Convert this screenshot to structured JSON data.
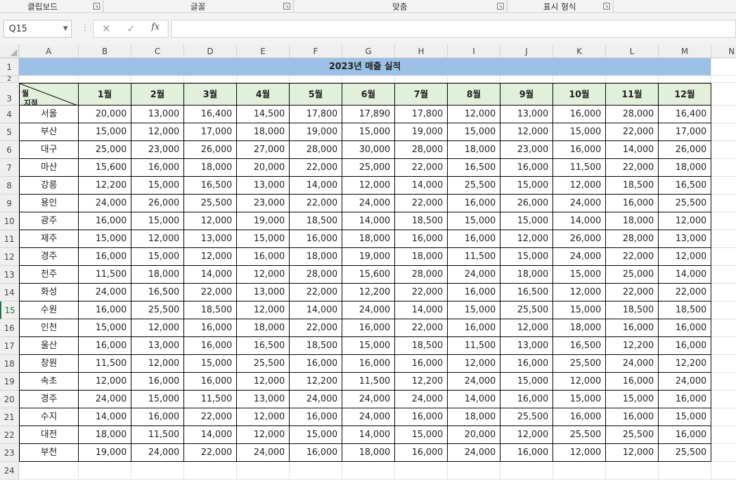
{
  "ribbon": {
    "groups": [
      {
        "label": "클립보드"
      },
      {
        "label": "글꼴"
      },
      {
        "label": "맞춤"
      },
      {
        "label": "표시 형식"
      }
    ]
  },
  "formula_bar": {
    "name_box": "Q15",
    "cancel_icon": "✕",
    "enter_icon": "✓",
    "fx_label": "fx",
    "formula": ""
  },
  "columns": [
    "A",
    "B",
    "C",
    "D",
    "E",
    "F",
    "G",
    "H",
    "I",
    "J",
    "K",
    "L",
    "M",
    "N"
  ],
  "rows": [
    "1",
    "2",
    "3",
    "4",
    "5",
    "6",
    "7",
    "8",
    "9",
    "10",
    "11",
    "12",
    "13",
    "14",
    "15",
    "16",
    "17",
    "18",
    "19",
    "20",
    "21",
    "22",
    "23",
    "24"
  ],
  "selected_row": "15",
  "sheet": {
    "title": "2023년 매출 실적",
    "header_corner": {
      "top": "월",
      "bottom": "지점"
    },
    "months": [
      "1월",
      "2월",
      "3월",
      "4월",
      "5월",
      "6월",
      "7월",
      "8월",
      "9월",
      "10월",
      "11월",
      "12월"
    ],
    "data": [
      {
        "branch": "서울",
        "values": [
          "20,000",
          "13,000",
          "16,400",
          "14,500",
          "17,800",
          "17,890",
          "17,800",
          "12,000",
          "13,000",
          "16,000",
          "28,000",
          "16,400"
        ]
      },
      {
        "branch": "부산",
        "values": [
          "15,000",
          "12,000",
          "17,000",
          "18,000",
          "19,000",
          "15,000",
          "19,000",
          "15,000",
          "12,000",
          "15,000",
          "22,000",
          "17,000"
        ]
      },
      {
        "branch": "대구",
        "values": [
          "25,000",
          "23,000",
          "26,000",
          "27,000",
          "28,000",
          "30,000",
          "28,000",
          "18,000",
          "23,000",
          "16,000",
          "14,000",
          "26,000"
        ]
      },
      {
        "branch": "마산",
        "values": [
          "15,600",
          "16,000",
          "18,000",
          "20,000",
          "22,000",
          "25,000",
          "22,000",
          "16,500",
          "16,000",
          "11,500",
          "22,000",
          "18,000"
        ]
      },
      {
        "branch": "강릉",
        "values": [
          "12,200",
          "15,000",
          "16,500",
          "13,000",
          "14,000",
          "12,000",
          "14,000",
          "25,500",
          "15,000",
          "12,000",
          "18,500",
          "16,500"
        ]
      },
      {
        "branch": "용인",
        "values": [
          "24,000",
          "26,000",
          "25,500",
          "23,000",
          "22,000",
          "24,000",
          "22,000",
          "16,000",
          "26,000",
          "24,000",
          "16,000",
          "25,500"
        ]
      },
      {
        "branch": "광주",
        "values": [
          "16,000",
          "15,000",
          "12,000",
          "19,000",
          "18,500",
          "14,000",
          "18,500",
          "15,000",
          "15,000",
          "14,000",
          "18,000",
          "12,000"
        ]
      },
      {
        "branch": "제주",
        "values": [
          "15,000",
          "12,000",
          "13,000",
          "15,000",
          "16,000",
          "18,000",
          "16,000",
          "16,000",
          "12,000",
          "26,000",
          "28,000",
          "13,000"
        ]
      },
      {
        "branch": "경주",
        "values": [
          "16,000",
          "15,000",
          "12,000",
          "16,000",
          "18,000",
          "19,000",
          "18,000",
          "11,500",
          "15,000",
          "24,000",
          "22,000",
          "12,000"
        ]
      },
      {
        "branch": "전주",
        "values": [
          "11,500",
          "18,000",
          "14,000",
          "12,000",
          "28,000",
          "15,600",
          "28,000",
          "24,000",
          "18,000",
          "15,000",
          "25,000",
          "14,000"
        ]
      },
      {
        "branch": "화성",
        "values": [
          "24,000",
          "16,500",
          "22,000",
          "13,000",
          "22,000",
          "12,200",
          "22,000",
          "16,000",
          "16,500",
          "12,000",
          "22,000",
          "22,000"
        ]
      },
      {
        "branch": "수원",
        "values": [
          "16,000",
          "25,500",
          "18,500",
          "12,000",
          "14,000",
          "24,000",
          "14,000",
          "15,000",
          "25,500",
          "15,000",
          "18,500",
          "18,500"
        ]
      },
      {
        "branch": "인천",
        "values": [
          "15,000",
          "12,000",
          "16,000",
          "18,000",
          "22,000",
          "16,000",
          "22,000",
          "16,000",
          "12,000",
          "18,000",
          "16,000",
          "16,000"
        ]
      },
      {
        "branch": "울산",
        "values": [
          "16,000",
          "13,000",
          "16,000",
          "16,500",
          "18,500",
          "15,000",
          "18,500",
          "11,500",
          "13,000",
          "16,500",
          "12,200",
          "16,000"
        ]
      },
      {
        "branch": "창원",
        "values": [
          "11,500",
          "12,000",
          "15,000",
          "25,500",
          "16,000",
          "16,000",
          "16,000",
          "12,000",
          "16,000",
          "25,500",
          "24,000",
          "12,200"
        ]
      },
      {
        "branch": "속초",
        "values": [
          "12,000",
          "16,000",
          "16,000",
          "12,000",
          "12,200",
          "11,500",
          "12,200",
          "24,000",
          "15,000",
          "12,000",
          "16,000",
          "24,000"
        ]
      },
      {
        "branch": "경주",
        "values": [
          "24,000",
          "15,000",
          "11,500",
          "13,000",
          "24,000",
          "24,000",
          "24,000",
          "14,000",
          "16,000",
          "15,000",
          "15,000",
          "16,000"
        ]
      },
      {
        "branch": "수지",
        "values": [
          "14,000",
          "16,000",
          "22,000",
          "12,000",
          "16,000",
          "24,000",
          "16,000",
          "18,000",
          "25,500",
          "16,000",
          "16,000",
          "15,000"
        ]
      },
      {
        "branch": "대전",
        "values": [
          "18,000",
          "11,500",
          "14,000",
          "12,000",
          "15,000",
          "14,000",
          "15,000",
          "20,000",
          "12,000",
          "25,500",
          "25,500",
          "16,000"
        ]
      },
      {
        "branch": "부천",
        "values": [
          "19,000",
          "24,000",
          "22,000",
          "24,000",
          "16,000",
          "18,000",
          "16,000",
          "24,000",
          "16,000",
          "12,000",
          "12,000",
          "25,500"
        ]
      }
    ]
  }
}
